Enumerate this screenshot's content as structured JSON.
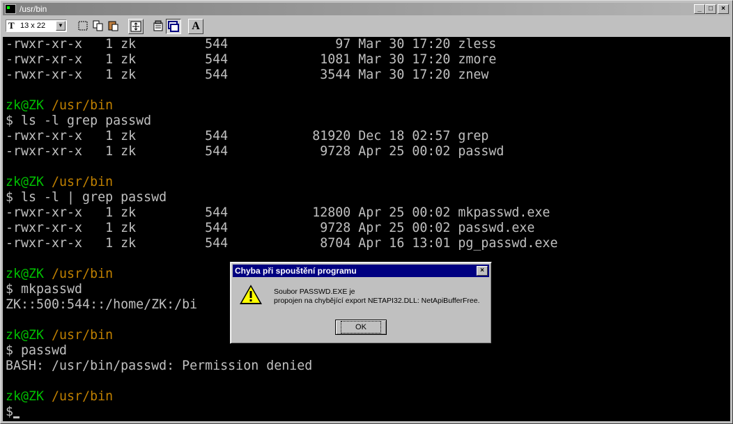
{
  "window": {
    "title": "/usr/bin",
    "minimize_icon": "minimize-icon",
    "maximize_icon": "maximize-icon",
    "close_icon": "close-icon"
  },
  "toolbar": {
    "font_size": "13 x 22",
    "tools": [
      "mark-icon",
      "copy-icon",
      "paste-icon",
      "fullscreen-icon",
      "properties-icon",
      "background-icon",
      "font-icon"
    ]
  },
  "terminal": {
    "lines": [
      "-rwxr-xr-x   1 zk         544              97 Mar 30 17:20 zless",
      "-rwxr-xr-x   1 zk         544            1081 Mar 30 17:20 zmore",
      "-rwxr-xr-x   1 zk         544            3544 Mar 30 17:20 znew",
      "",
      "",
      "$ ls -l grep passwd",
      "-rwxr-xr-x   1 zk         544           81920 Dec 18 02:57 grep",
      "-rwxr-xr-x   1 zk         544            9728 Apr 25 00:02 passwd",
      "",
      "",
      "$ ls -l | grep passwd",
      "-rwxr-xr-x   1 zk         544           12800 Apr 25 00:02 mkpasswd.exe",
      "-rwxr-xr-x   1 zk         544            9728 Apr 25 00:02 passwd.exe",
      "-rwxr-xr-x   1 zk         544            8704 Apr 16 13:01 pg_passwd.exe",
      "",
      "",
      "$ mkpasswd",
      "ZK::500:544::/home/ZK:/bi",
      "",
      "",
      "$ passwd",
      "BASH: /usr/bin/passwd: Permission denied",
      "",
      "",
      "$"
    ],
    "prompt_user": "zk@ZK",
    "prompt_path": "/usr/bin"
  },
  "dialog": {
    "title": "Chyba při spouštění programu",
    "message_line1": "Soubor PASSWD.EXE je",
    "message_line2": "propojen na chybějící export NETAPI32.DLL: NetApiBufferFree.",
    "ok_label": "OK",
    "icon": "warning-icon"
  },
  "colors": {
    "terminal_bg": "#000000",
    "text": "#c0c0c0",
    "prompt_user": "#00c000",
    "prompt_path": "#c08000",
    "dialog_title_bg": "#000080"
  }
}
